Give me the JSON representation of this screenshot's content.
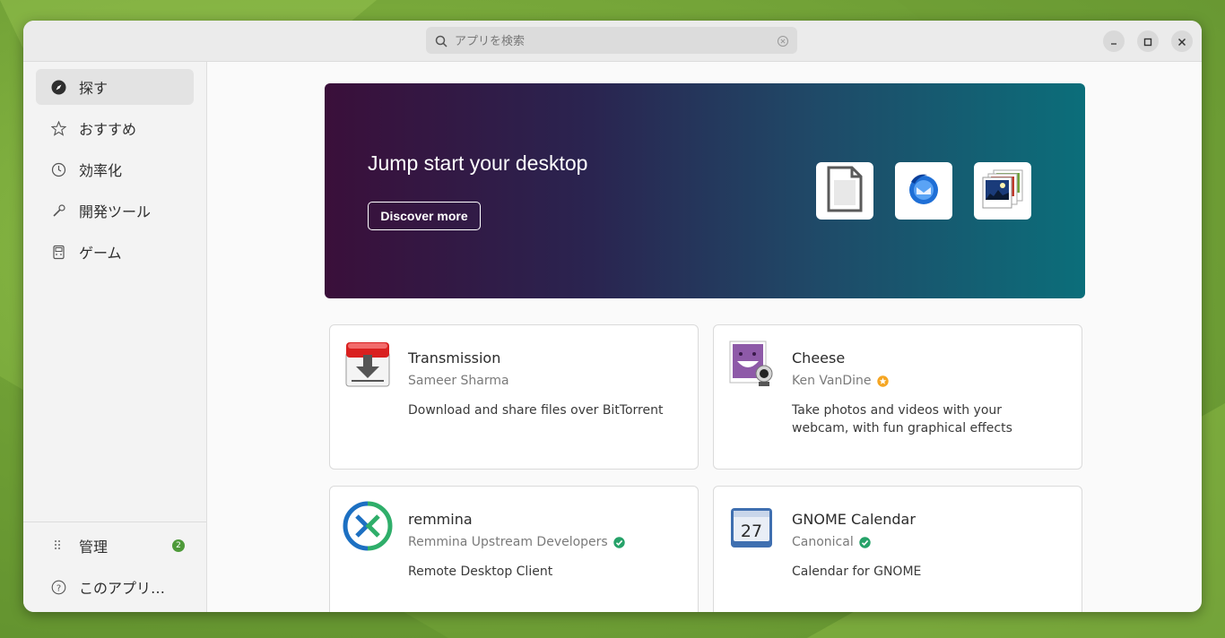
{
  "search": {
    "placeholder": "アプリを検索"
  },
  "window_controls": {
    "minimize_icon": "minimize-icon",
    "maximize_icon": "maximize-icon",
    "close_icon": "close-icon"
  },
  "sidebar": {
    "items": [
      {
        "label": "探す",
        "icon": "compass-icon",
        "active": true
      },
      {
        "label": "おすすめ",
        "icon": "star-icon"
      },
      {
        "label": "効率化",
        "icon": "clock-icon"
      },
      {
        "label": "開発ツール",
        "icon": "wrench-icon"
      },
      {
        "label": "ゲーム",
        "icon": "gamepad-icon"
      }
    ],
    "bottom": [
      {
        "label": "管理",
        "icon": "grid-dots-icon",
        "badge": "2"
      },
      {
        "label": "このアプリ…",
        "icon": "help-icon"
      }
    ]
  },
  "banner": {
    "title": "Jump start your desktop",
    "button": "Discover more",
    "tiles": [
      "libreoffice-icon",
      "thunderbird-icon",
      "shotwell-icon"
    ]
  },
  "apps": [
    {
      "name": "Transmission",
      "developer": "Sameer Sharma",
      "developer_mark": "",
      "description": "Download and share files over BitTorrent",
      "icon": "transmission-icon"
    },
    {
      "name": "Cheese",
      "developer": "Ken VanDine",
      "developer_mark": "star-badge-icon",
      "description": "Take photos and videos with your webcam, with fun graphical effects",
      "icon": "cheese-icon"
    },
    {
      "name": "remmina",
      "developer": "Remmina Upstream Developers",
      "developer_mark": "verified-icon",
      "description": "Remote Desktop Client",
      "icon": "remmina-icon"
    },
    {
      "name": "GNOME Calendar",
      "developer": "Canonical",
      "developer_mark": "verified-icon",
      "description": "Calendar for GNOME",
      "icon": "gnome-calendar-icon",
      "icon_day": "27"
    }
  ],
  "colors": {
    "accent_green": "#4e9a3a",
    "verified": "#26a269",
    "star_badge": "#f5a623"
  }
}
